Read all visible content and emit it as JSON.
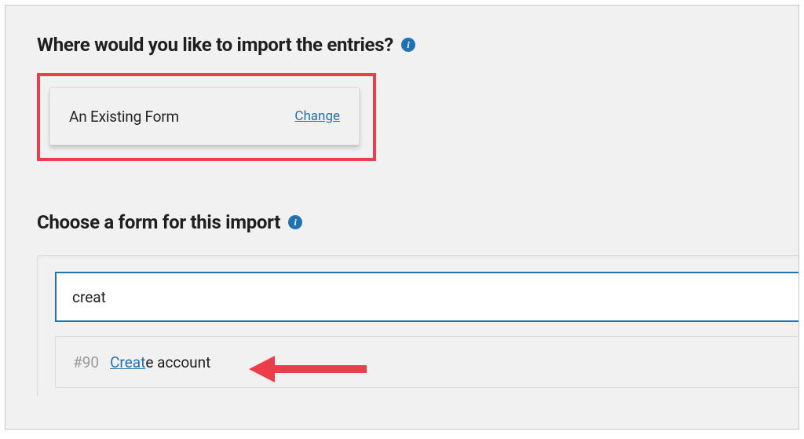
{
  "section1": {
    "title": "Where would you like to import the entries?",
    "option_label": "An Existing Form",
    "change_label": "Change"
  },
  "section2": {
    "title": "Choose a form for this import",
    "search_value": "creat",
    "result": {
      "id_prefix": "#90",
      "match": "Creat",
      "rest": "e account"
    }
  },
  "info_glyph": "i",
  "colors": {
    "accent": "#2271b1",
    "highlight": "#ea3e4a"
  }
}
